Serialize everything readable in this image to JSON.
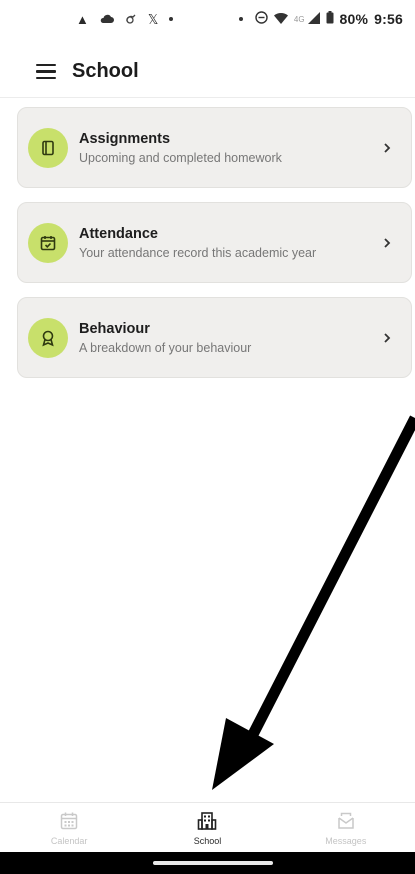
{
  "status_bar": {
    "left_icons": [
      "navigation-arrow-icon",
      "cloud-icon",
      "weather-icon",
      "x-app-icon",
      "dot"
    ],
    "right_icons": [
      "dot",
      "do-not-disturb-icon",
      "wifi-icon",
      "signal-icon",
      "battery-icon"
    ],
    "network_label": "4G",
    "battery": "80%",
    "time": "9:56"
  },
  "app_bar": {
    "title": "School"
  },
  "cards": [
    {
      "icon": "book-icon",
      "title": "Assignments",
      "subtitle": "Upcoming and completed homework"
    },
    {
      "icon": "calendar-check-icon",
      "title": "Attendance",
      "subtitle": "Your attendance record this academic year"
    },
    {
      "icon": "award-icon",
      "title": "Behaviour",
      "subtitle": "A breakdown of your behaviour"
    }
  ],
  "bottom_nav": [
    {
      "icon": "calendar-icon",
      "label": "Calendar",
      "active": false
    },
    {
      "icon": "building-icon",
      "label": "School",
      "active": true
    },
    {
      "icon": "mail-icon",
      "label": "Messages",
      "active": false
    }
  ],
  "colors": {
    "accent": "#c8e06b",
    "card_bg": "#f0efed",
    "annotation_arrow": "#000000"
  }
}
